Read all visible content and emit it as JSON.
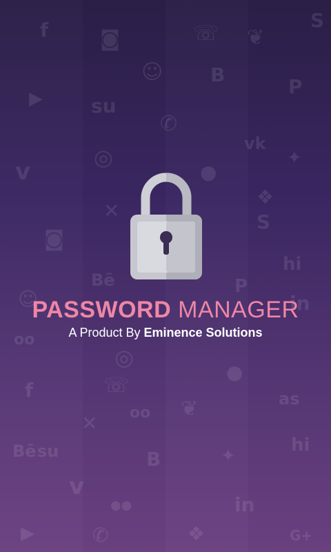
{
  "app": {
    "title_bold": "PASSWORD",
    "title_regular": "MANAGER",
    "subtitle_prefix": "A Product By",
    "subtitle_company": "Eminence Solutions"
  },
  "colors": {
    "title": "#ef86a6",
    "subtitle": "#ffffff",
    "bg_top": "#2b1f47",
    "bg_bottom": "#6c4181"
  },
  "background_icons": [
    {
      "name": "facebook-icon",
      "glyph": "f"
    },
    {
      "name": "instagram-icon",
      "glyph": "◙"
    },
    {
      "name": "whatsapp-icon",
      "glyph": "☏"
    },
    {
      "name": "evernote-icon",
      "glyph": "❦"
    },
    {
      "name": "skype-icon",
      "glyph": "S"
    },
    {
      "name": "snapchat-icon",
      "glyph": "☺"
    },
    {
      "name": "blogger-icon",
      "glyph": "B"
    },
    {
      "name": "pinterest-icon",
      "glyph": "P"
    },
    {
      "name": "youtube-icon",
      "glyph": "▶"
    },
    {
      "name": "stumbleupon-icon",
      "glyph": "su"
    },
    {
      "name": "phone-icon",
      "glyph": "✆"
    },
    {
      "name": "vk-icon",
      "glyph": "vk"
    },
    {
      "name": "twitter-icon",
      "glyph": "✦"
    },
    {
      "name": "dribbble-icon",
      "glyph": "◎"
    },
    {
      "name": "apple-icon",
      "glyph": ""
    },
    {
      "name": "vimeo-icon",
      "glyph": "v"
    },
    {
      "name": "xing-icon",
      "glyph": "✕"
    },
    {
      "name": "dropbox-icon",
      "glyph": "❖"
    },
    {
      "name": "hi5-icon",
      "glyph": "hi"
    },
    {
      "name": "behance-icon",
      "glyph": "Bē"
    },
    {
      "name": "linkedin-icon",
      "glyph": "in"
    },
    {
      "name": "tripadvisor-icon",
      "glyph": "oo"
    },
    {
      "name": "lastfm-icon",
      "glyph": "as"
    },
    {
      "name": "google-plus-icon",
      "glyph": "G+"
    },
    {
      "name": "flickr-icon",
      "glyph": "●●"
    }
  ]
}
